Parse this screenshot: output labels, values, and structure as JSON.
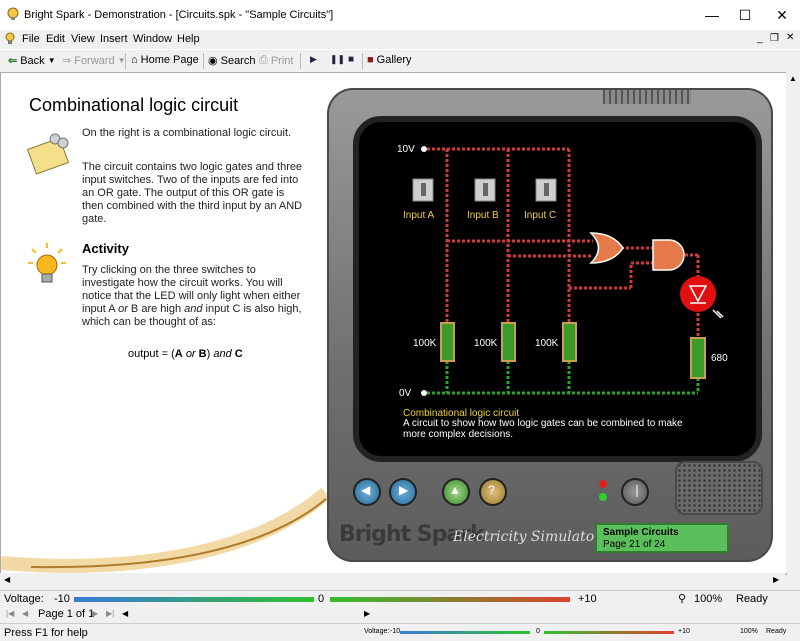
{
  "window": {
    "title": "Bright Spark - Demonstration - [Circuits.spk - \"Sample Circuits\"]"
  },
  "menu": [
    "File",
    "Edit",
    "View",
    "Insert",
    "Window",
    "Help"
  ],
  "toolbar": {
    "back": "Back",
    "forward": "Forward",
    "home": "Home Page",
    "search": "Search",
    "print": "Print",
    "gallery": "Gallery"
  },
  "article": {
    "heading": "Combinational logic circuit",
    "p1": "On the right is a combinational logic circuit.",
    "p2": "The circuit contains two logic gates and three input switches. Two of the inputs are fed into an OR gate. The output of this OR gate is then combined with the third input by an AND gate.",
    "activity_heading": "Activity",
    "p3a": "Try clicking on the three switches to investigate how the circuit works. You will notice that the LED will only light when either input A ",
    "p3or": "or",
    "p3b": " B are high ",
    "p3and": "and",
    "p3c": " input C is also high, which can be thought of as:",
    "formula": {
      "prefix": "output = (",
      "a": "A",
      "or": "or",
      "b": "B",
      "close": ")",
      "and": "and",
      "c": "C"
    }
  },
  "circuit": {
    "v_high": "10V",
    "v_low": "0V",
    "inputs": [
      "Input A",
      "Input B",
      "Input C"
    ],
    "resistors": [
      "100K",
      "100K",
      "100K"
    ],
    "led_resistor": "680",
    "caption_title": "Combinational logic circuit",
    "caption_text": "A circuit to show how two logic gates can be combined to make more complex decisions."
  },
  "monitor": {
    "brand": "Bright Spark",
    "subtitle": "Electricity Simulator",
    "page_title": "Sample Circuits",
    "page_count": "Page 21 of 24"
  },
  "voltage_bar": {
    "label": "Voltage:",
    "min": "-10",
    "mid": "0",
    "max": "+10",
    "zoom": "100%",
    "status": "Ready"
  },
  "pager": {
    "label": "Page 1 of 1"
  },
  "mini_bar": {
    "label": "Voltage:",
    "min": "-10",
    "mid": "0",
    "max": "+10",
    "zoom": "100%",
    "status": "Ready"
  },
  "statusbar": {
    "help": "Press F1 for help"
  },
  "colors": {
    "wire_high": "#d23a3a",
    "wire_low": "#2aa52a",
    "led": "#e01010"
  }
}
